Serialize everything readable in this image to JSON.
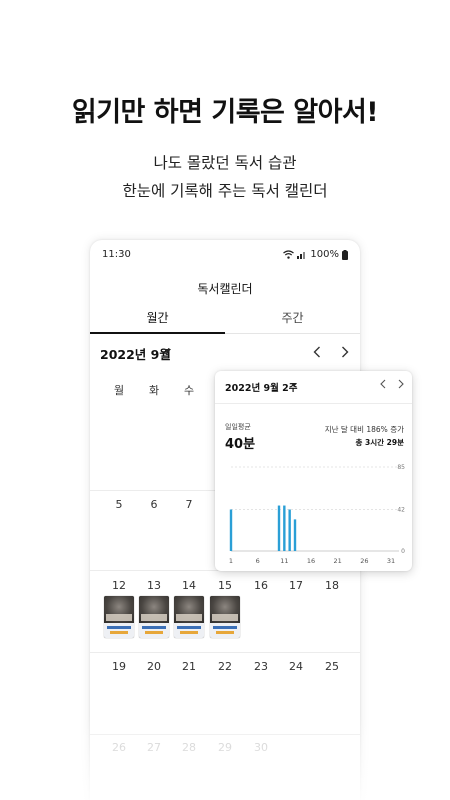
{
  "promo": {
    "headline": "읽기만 하면 기록은 알아서!",
    "subline1": "나도 몰랐던 독서 습관",
    "subline2": "한눈에 기록해 주는 독서 캘린더"
  },
  "status_bar": {
    "time": "11:30",
    "battery": "100%"
  },
  "app": {
    "title": "독서캘린더",
    "tabs": [
      "월간",
      "주간"
    ],
    "active_tab": "월간"
  },
  "calendar": {
    "month_label": "2022년 9월",
    "weekdays": [
      "월",
      "화",
      "수"
    ],
    "rows": [
      [
        "5",
        "6",
        "7"
      ],
      [
        "12",
        "13",
        "14",
        "15",
        "16",
        "17",
        "18"
      ],
      [
        "19",
        "20",
        "21",
        "22",
        "23",
        "24",
        "25"
      ],
      [
        "26",
        "27",
        "28",
        "29",
        "30"
      ]
    ],
    "book_days": [
      "12",
      "13",
      "14",
      "15"
    ]
  },
  "weekly_popup": {
    "week_label": "2022년 9월 2주",
    "avg_label": "일일평균",
    "avg_value": "40분",
    "compare_text": "지난 달 대비 186% 증가",
    "total_text": "총 3시간 29분"
  },
  "chart_data": {
    "type": "bar",
    "x": [
      1,
      7,
      10,
      11,
      12,
      13
    ],
    "values": [
      42,
      0,
      46,
      46,
      42,
      32
    ],
    "xticks": [
      "1",
      "6",
      "11",
      "16",
      "21",
      "26",
      "31"
    ],
    "yticks": [
      "0",
      "42",
      "85"
    ],
    "ylim": [
      0,
      85
    ],
    "xlim": [
      1,
      31
    ],
    "bar_color": "#2a9fd6"
  }
}
